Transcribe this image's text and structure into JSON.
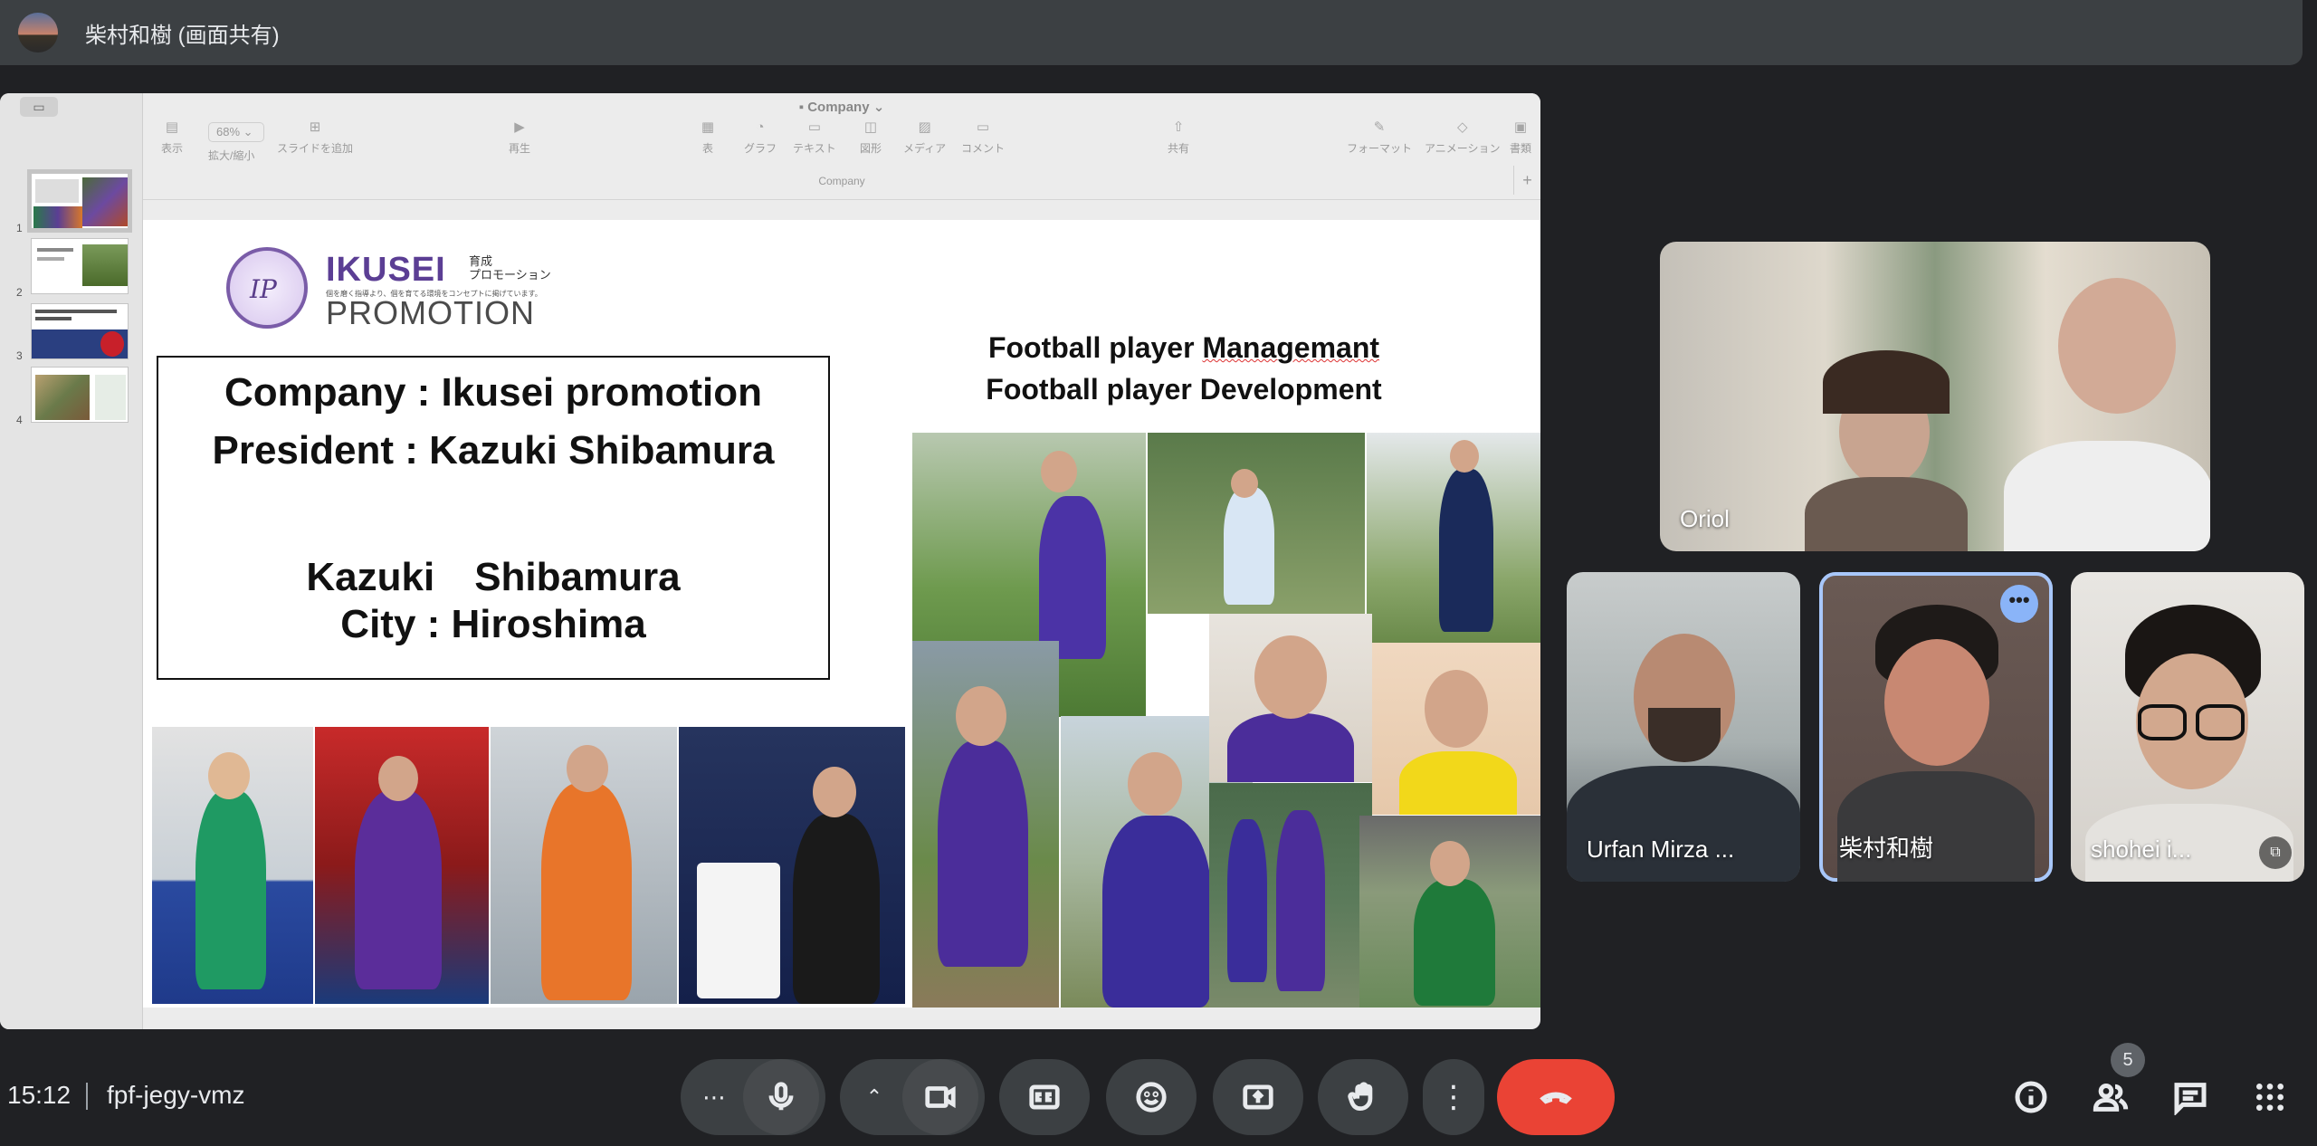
{
  "presenter": {
    "name": "柴村和樹 (画面共有)"
  },
  "keynote": {
    "doc_title": "Company",
    "doc_subtitle": "Company",
    "zoom": "68%",
    "toolbar": [
      {
        "label": "表示",
        "icon": "view-icon"
      },
      {
        "label": "拡大/縮小",
        "icon": "zoom-icon"
      },
      {
        "label": "スライドを追加",
        "icon": "add-slide-icon"
      },
      {
        "label": "再生",
        "icon": "play-icon"
      },
      {
        "label": "表",
        "icon": "table-icon"
      },
      {
        "label": "グラフ",
        "icon": "chart-icon"
      },
      {
        "label": "テキスト",
        "icon": "text-icon"
      },
      {
        "label": "図形",
        "icon": "shape-icon"
      },
      {
        "label": "メディア",
        "icon": "media-icon"
      },
      {
        "label": "コメント",
        "icon": "comment-icon"
      },
      {
        "label": "共有",
        "icon": "share-icon"
      },
      {
        "label": "フォーマット",
        "icon": "format-icon"
      },
      {
        "label": "アニメーション",
        "icon": "animation-icon"
      },
      {
        "label": "書類",
        "icon": "document-icon"
      }
    ],
    "slide_numbers": [
      "1",
      "2",
      "3",
      "4"
    ],
    "slide": {
      "logo_ikusei": "IKUSEI",
      "logo_jp": "育成\nプロモーション",
      "logo_tag": "個を磨く指導より、個を育てる環境をコンセプトに掲げています。",
      "logo_promotion": "PROMOTION",
      "logo_circle": "IP",
      "line1": "Company : Ikusei promotion",
      "line2": "President : Kazuki Shibamura",
      "line3": "Kazuki　Shibamura",
      "line4": "City : Hiroshima",
      "tagline1_a": "Football player ",
      "tagline1_b": "Managemant",
      "tagline2": "Football player Development"
    }
  },
  "participants": [
    {
      "name": "Oriol"
    },
    {
      "name": "Urfan Mirza ..."
    },
    {
      "name": "柴村和樹"
    },
    {
      "name": "shohei i..."
    }
  ],
  "footer": {
    "time": "15:12",
    "meeting_code": "fpf-jegy-vmz",
    "people_count": "5"
  },
  "colors": {
    "end_call": "#ea4335",
    "active_speaker": "#a8c7fa",
    "brand_purple": "#5b3e94"
  }
}
